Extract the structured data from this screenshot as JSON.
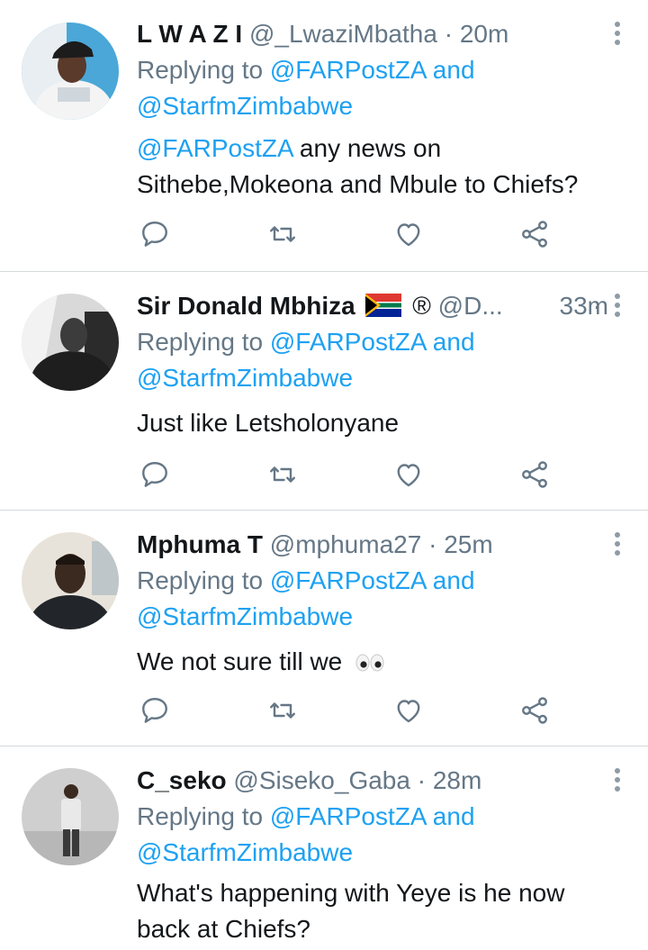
{
  "tweets": [
    {
      "name": "L W A Z I",
      "handle": "@_LwaziMbatha",
      "separator": "·",
      "time": "20m",
      "replying_prefix": "Replying to",
      "reply_to_1": "@FARPostZA",
      "reply_joiner": "and",
      "reply_to_2": "@StarfmZimbabwe",
      "mention": "@FARPostZA",
      "text_1": "any news on",
      "text_2": "Sithebe,Mokeona and Mbule to Chiefs?"
    },
    {
      "name": "Sir Donald Mbhiza",
      "name_suffix": "®",
      "handle": "@D...",
      "separator": "·",
      "time": "33m",
      "replying_prefix": "Replying to",
      "reply_to_1": "@FARPostZA",
      "reply_joiner": "and",
      "reply_to_2": "@StarfmZimbabwe",
      "text": "Just like Letsholonyane"
    },
    {
      "name": "Mphuma T",
      "handle": "@mphuma27",
      "separator": "·",
      "time": "25m",
      "replying_prefix": "Replying to",
      "reply_to_1": "@FARPostZA",
      "reply_joiner": "and",
      "reply_to_2": "@StarfmZimbabwe",
      "text": "We not sure till we"
    },
    {
      "name": "C_seko",
      "handle": "@Siseko_Gaba",
      "separator": "·",
      "time": "28m",
      "replying_prefix": "Replying to",
      "reply_to_1": "@FARPostZA",
      "reply_joiner": "and",
      "reply_to_2": "@StarfmZimbabwe",
      "text_1": "What's happening with Yeye is he now",
      "text_2": "back at Chiefs?"
    }
  ],
  "icons": {
    "reply": "reply-icon",
    "retweet": "retweet-icon",
    "like": "heart-icon",
    "share": "share-icon",
    "menu": "more-vertical-icon"
  },
  "colors": {
    "link": "#1da1f2",
    "secondary": "#657786",
    "icon": "#657786",
    "divider": "#d4d9dd"
  }
}
